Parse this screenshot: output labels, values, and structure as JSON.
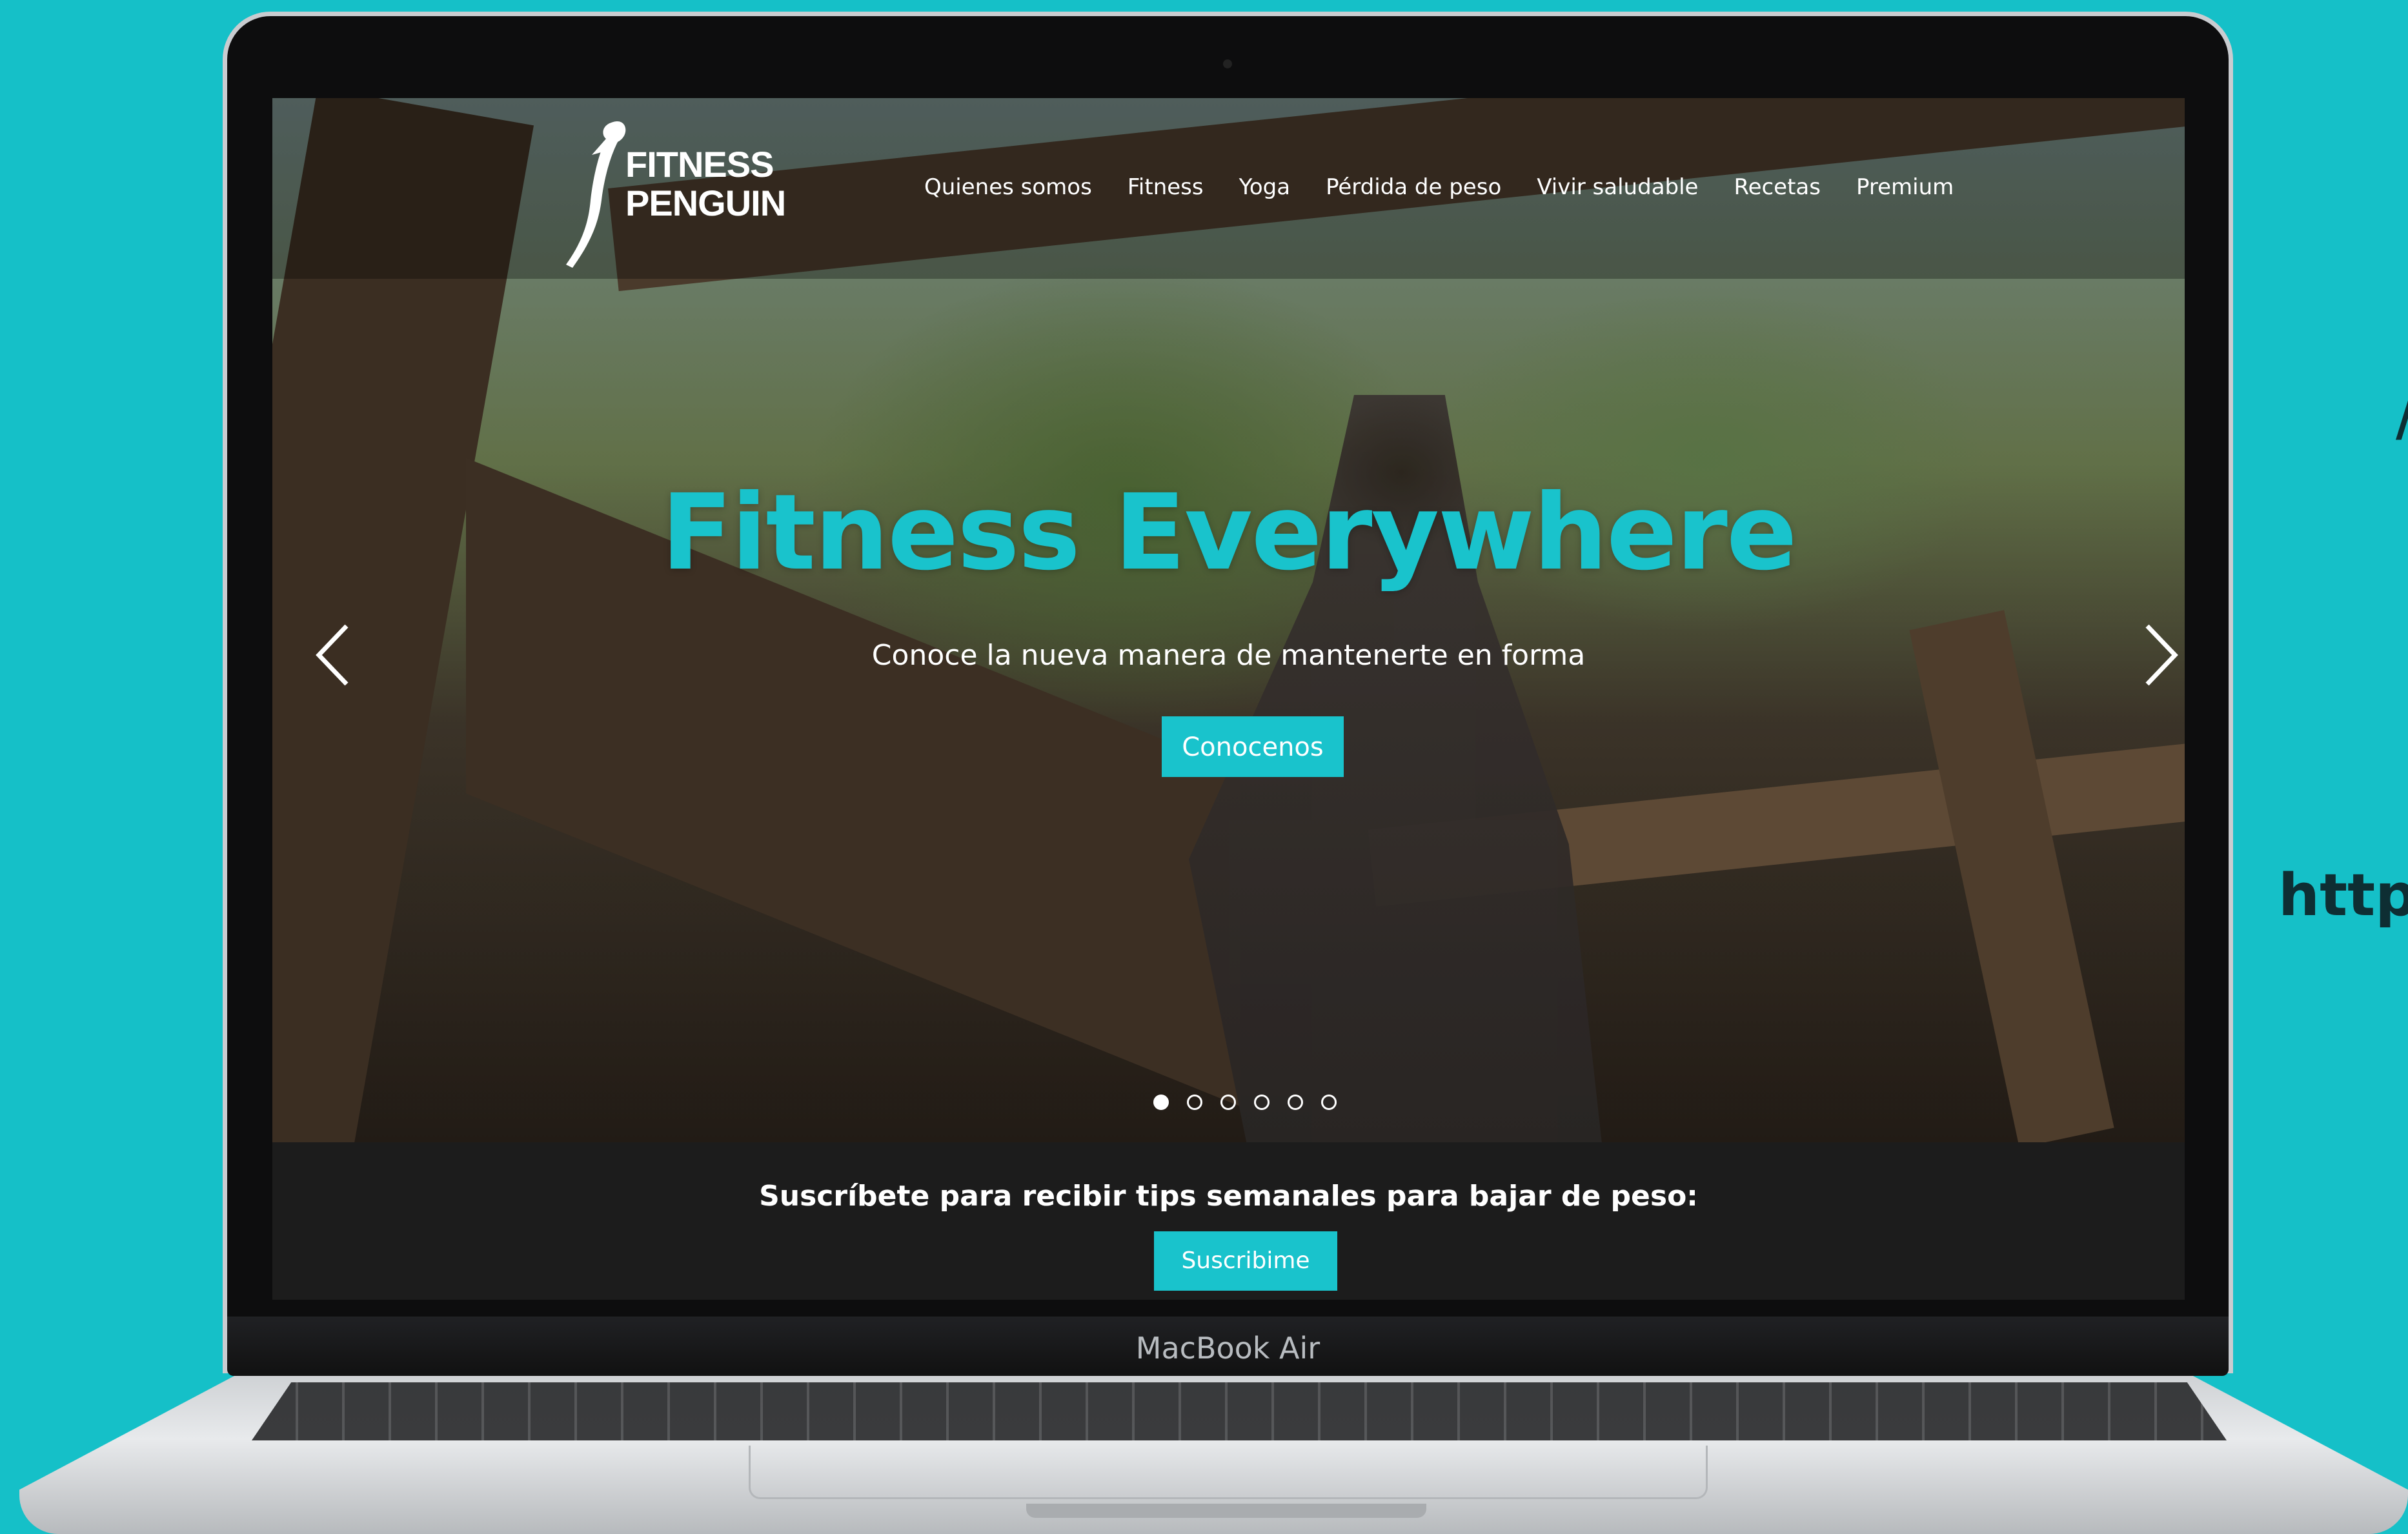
{
  "site": {
    "logo": {
      "line1": "FITNESS",
      "line2": "PENGUIN"
    },
    "nav": [
      {
        "label": "Quienes somos"
      },
      {
        "label": "Fitness"
      },
      {
        "label": "Yoga"
      },
      {
        "label": "Pérdida de peso"
      },
      {
        "label": "Vivir saludable"
      },
      {
        "label": "Recetas"
      },
      {
        "label": "Premium"
      }
    ],
    "hero": {
      "title": "Fitness Everywhere",
      "subtitle": "Conoce la nueva manera de mantenerte en forma",
      "cta_label": "Conocenos",
      "slides_total": 6,
      "active_slide": 1,
      "prev_icon": "chevron-left-icon",
      "next_icon": "chevron-right-icon"
    },
    "subscribe": {
      "text": "Suscríbete para recibir tips semanales para bajar de peso:",
      "button_label": "Suscribime"
    }
  },
  "device": {
    "label": "MacBook Air"
  },
  "background": {
    "side_text": "http",
    "side_mark": "/"
  },
  "colors": {
    "accent": "#19c3cc",
    "background": "#15c0c8",
    "subscribe_bar": "#1c1c1c"
  }
}
